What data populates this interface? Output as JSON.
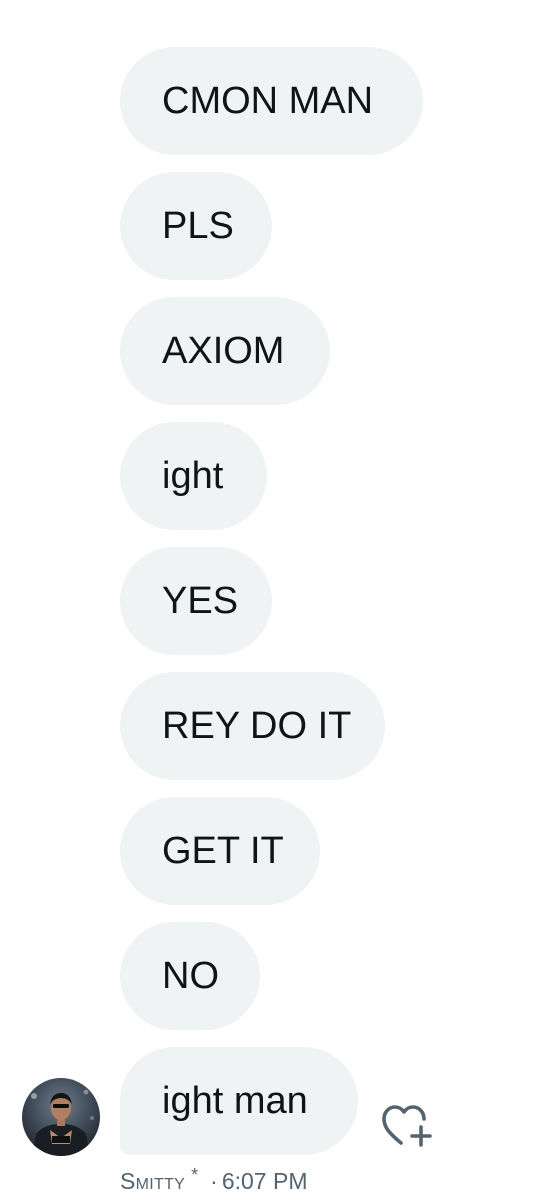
{
  "messages": [
    {
      "text": "CMON MAN"
    },
    {
      "text": "PLS"
    },
    {
      "text": "AXIOM"
    },
    {
      "text": "ight"
    },
    {
      "text": "YES"
    },
    {
      "text": "REY DO IT"
    },
    {
      "text": "GET IT"
    },
    {
      "text": "NO"
    },
    {
      "text": "ight man"
    }
  ],
  "footer": {
    "sender_name": "Smitty",
    "sender_badge": "*",
    "separator": "·",
    "time": "6:07 PM"
  },
  "icons": {
    "react": "heart-plus-icon",
    "avatar": "user-avatar"
  },
  "colors": {
    "bubble_bg": "#eff3f4",
    "text": "#0f1419",
    "secondary_text": "#536471",
    "background": "#ffffff"
  }
}
